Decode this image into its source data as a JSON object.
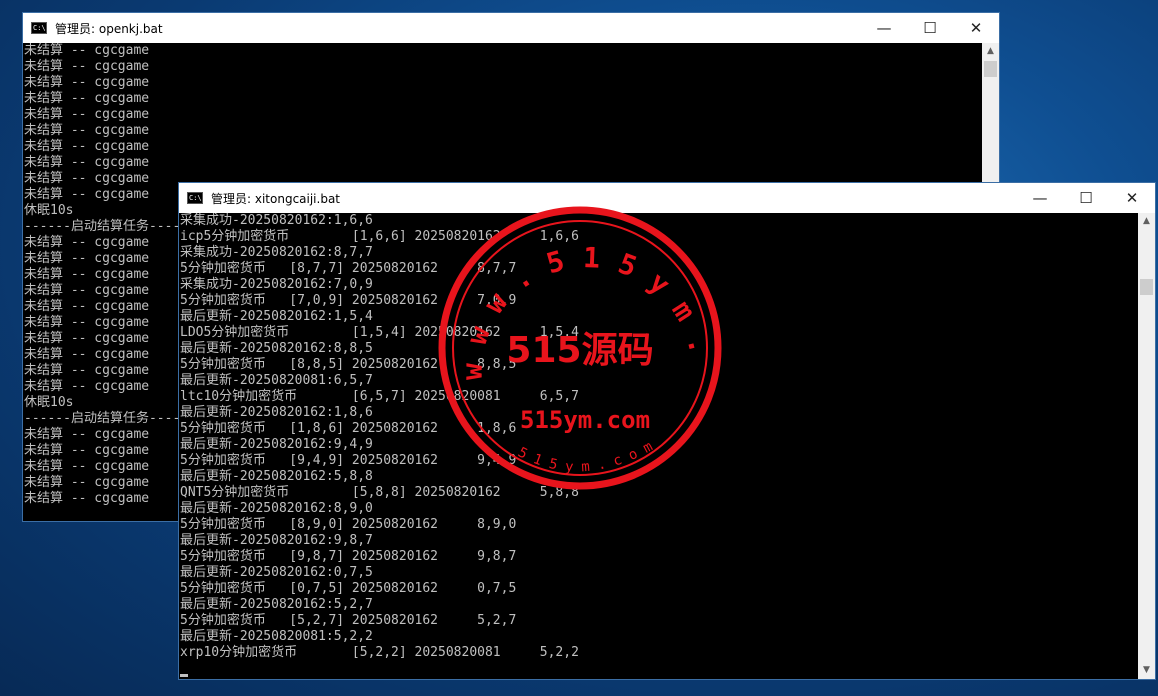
{
  "window_back": {
    "title": "管理员:  openkj.bat",
    "lines": [
      "未结算 -- cgcgame",
      "未结算 -- cgcgame",
      "未结算 -- cgcgame",
      "未结算 -- cgcgame",
      "未结算 -- cgcgame",
      "未结算 -- cgcgame",
      "未结算 -- cgcgame",
      "未结算 -- cgcgame",
      "未结算 -- cgcgame",
      "未结算 -- cgcgame",
      "休眠10s",
      "------启动结算任务------",
      "未结算 -- cgcgame",
      "未结算 -- cgcgame",
      "未结算 -- cgcgame",
      "未结算 -- cgcgame",
      "未结算 -- cgcgame",
      "未结算 -- cgcgame",
      "未结算 -- cgcgame",
      "未结算 -- cgcgame",
      "未结算 -- cgcgame",
      "未结算 -- cgcgame",
      "休眠10s",
      "------启动结算任务------",
      "未结算 -- cgcgame",
      "未结算 -- cgcgame",
      "未结算 -- cgcgame",
      "未结算 -- cgcgame",
      "未结算 -- cgcgame"
    ]
  },
  "window_front": {
    "title": "管理员:  xitongcaiji.bat",
    "lines": [
      "采集成功-20250820162:1,6,6",
      "icp5分钟加密货币        [1,6,6] 20250820162     1,6,6",
      "采集成功-20250820162:8,7,7",
      "5分钟加密货币   [8,7,7] 20250820162     8,7,7",
      "采集成功-20250820162:7,0,9",
      "5分钟加密货币   [7,0,9] 20250820162     7,0,9",
      "最后更新-20250820162:1,5,4",
      "LDO5分钟加密货币        [1,5,4] 20250820162     1,5,4",
      "最后更新-20250820162:8,8,5",
      "5分钟加密货币   [8,8,5] 20250820162     8,8,5",
      "最后更新-20250820081:6,5,7",
      "ltc10分钟加密货币       [6,5,7] 20250820081     6,5,7",
      "最后更新-20250820162:1,8,6",
      "5分钟加密货币   [1,8,6] 20250820162     1,8,6",
      "最后更新-20250820162:9,4,9",
      "5分钟加密货币   [9,4,9] 20250820162     9,4,9",
      "最后更新-20250820162:5,8,8",
      "QNT5分钟加密货币        [5,8,8] 20250820162     5,8,8",
      "最后更新-20250820162:8,9,0",
      "5分钟加密货币   [8,9,0] 20250820162     8,9,0",
      "最后更新-20250820162:9,8,7",
      "5分钟加密货币   [9,8,7] 20250820162     9,8,7",
      "最后更新-20250820162:0,7,5",
      "5分钟加密货币   [0,7,5] 20250820162     0,7,5",
      "最后更新-20250820162:5,2,7",
      "5分钟加密货币   [5,2,7] 20250820162     5,2,7",
      "最后更新-20250820081:5,2,2",
      "xrp10分钟加密货币       [5,2,2] 20250820081     5,2,2"
    ]
  },
  "window_controls": {
    "minimize": "—",
    "maximize": "☐",
    "close": "✕"
  },
  "app_icon_text": "C:\\",
  "watermark": {
    "ring_text": "w w w . 5 1 5 y m . c o m",
    "center_text": "515源码",
    "site_text": "515ym.com",
    "bottom_text": "5 1 5 y m . c o m",
    "color": "#e8141c"
  }
}
